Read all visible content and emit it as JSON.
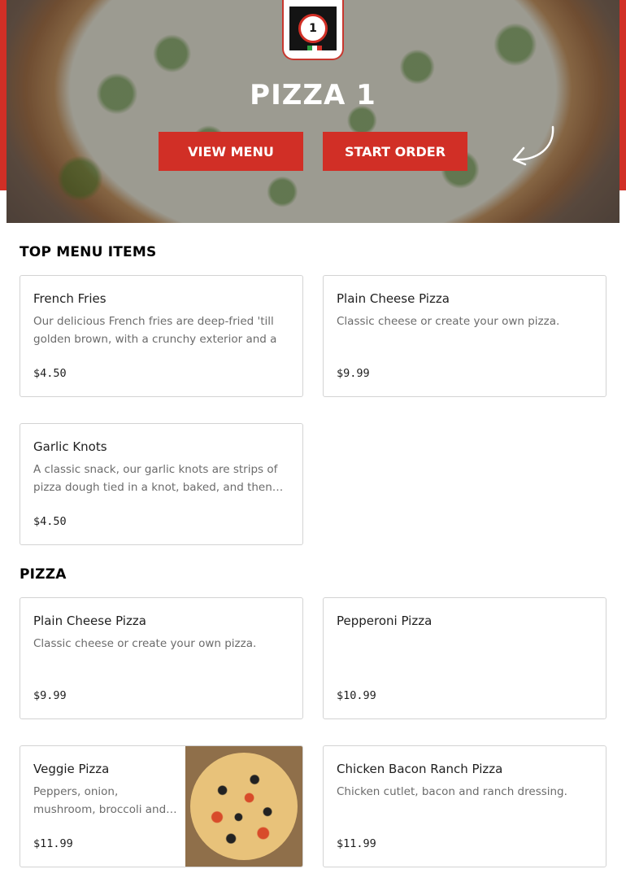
{
  "hero": {
    "title": "PIZZA 1",
    "logo_text": "1",
    "view_menu_label": "VIEW MENU",
    "start_order_label": "START ORDER"
  },
  "sections": [
    {
      "title": "TOP MENU ITEMS",
      "items": [
        {
          "name": "French Fries",
          "description": "Our delicious French fries are deep-fried 'till golden brown, with a crunchy exterior and a lig…",
          "price": "$4.50"
        },
        {
          "name": "Plain Cheese Pizza",
          "description": "Classic cheese or create your own pizza.",
          "price": "$9.99"
        },
        {
          "name": "Garlic Knots",
          "description": "A classic snack, our garlic knots are strips of pizza dough tied in a knot, baked, and then…",
          "price": "$4.50"
        }
      ]
    },
    {
      "title": "PIZZA",
      "items": [
        {
          "name": "Plain Cheese Pizza",
          "description": "Classic cheese or create your own pizza.",
          "price": "$9.99"
        },
        {
          "name": "Pepperoni Pizza",
          "description": "",
          "price": "$10.99"
        },
        {
          "name": "Veggie Pizza",
          "description": "Peppers, onion, mushroom, broccoli and…",
          "price": "$11.99"
        },
        {
          "name": "Chicken Bacon Ranch Pizza",
          "description": "Chicken cutlet, bacon and ranch dressing.",
          "price": "$11.99"
        }
      ]
    }
  ],
  "colors": {
    "brand_red": "#d12f26",
    "border": "#d3d3d3"
  }
}
